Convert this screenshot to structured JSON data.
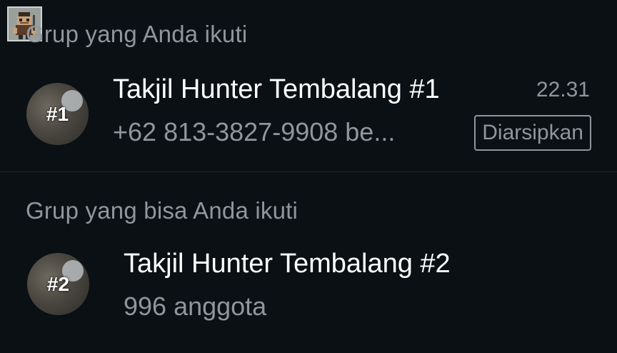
{
  "sections": {
    "joined_heading": "Grup yang Anda ikuti",
    "joinable_heading": "Grup yang bisa Anda ikuti"
  },
  "joined_groups": [
    {
      "name": "Takjil Hunter Tembalang #1",
      "time": "22.31",
      "subtitle": "+62 813-3827-9908 be...",
      "badge": "Diarsipkan",
      "avatar_text": "#1"
    }
  ],
  "joinable_groups": [
    {
      "name": "Takjil Hunter Tembalang #2",
      "subtitle": "996 anggota",
      "avatar_text": "#2"
    }
  ],
  "colors": {
    "background": "#0b1014",
    "primary_text": "#ffffff",
    "secondary_text": "#8d979c"
  }
}
